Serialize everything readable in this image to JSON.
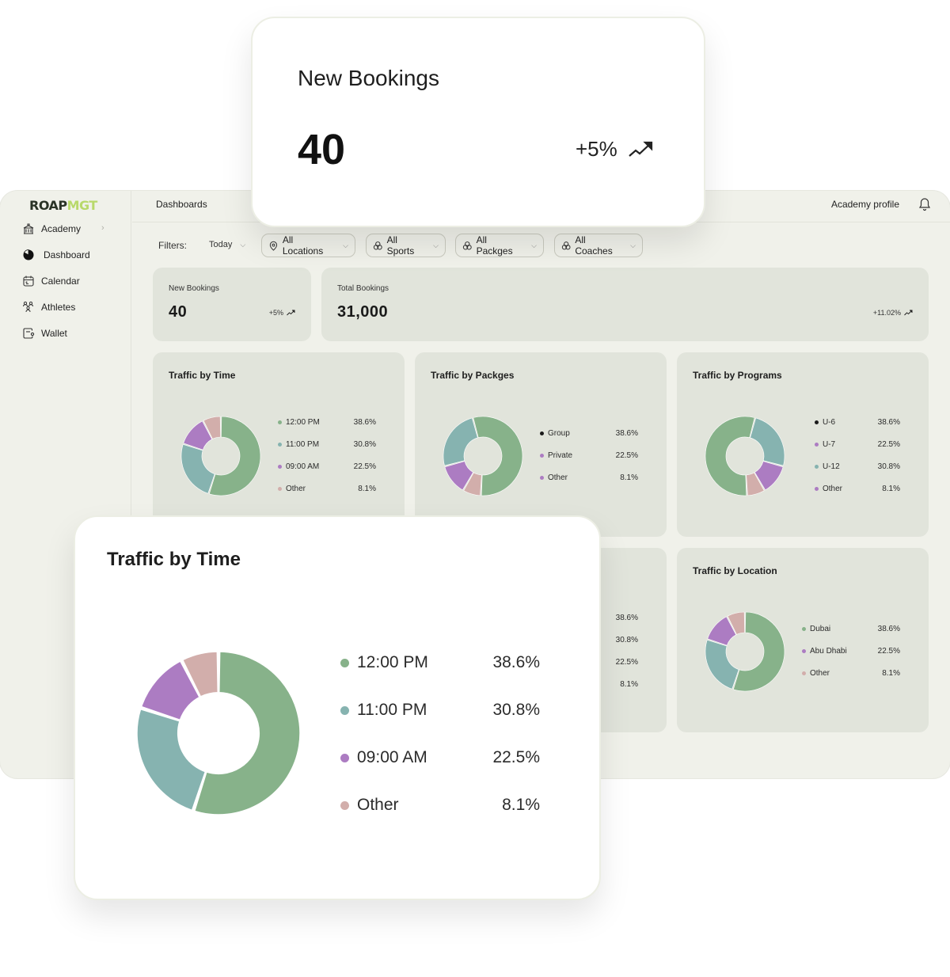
{
  "app": {
    "logo": {
      "part1": "ROAP",
      "part2": "MGT"
    },
    "sidebar": {
      "items": [
        {
          "label": "Academy",
          "icon": "building-icon",
          "has_chevron": true
        },
        {
          "label": "Dashboard",
          "icon": "pie-chart-icon"
        },
        {
          "label": "Calendar",
          "icon": "calendar-icon"
        },
        {
          "label": "Athletes",
          "icon": "users-icon"
        },
        {
          "label": "Wallet",
          "icon": "wallet-icon"
        }
      ]
    },
    "topbar": {
      "breadcrumb": "Dashboards",
      "profile": "Academy profile",
      "bell_icon": "bell-icon"
    },
    "filters": {
      "label": "Filters:",
      "date": "Today",
      "pills": [
        {
          "label": "All Locations",
          "icon": "location-pin-icon"
        },
        {
          "label": "All Sports",
          "icon": "sports-icon"
        },
        {
          "label": "All Packges",
          "icon": "packages-icon"
        },
        {
          "label": "All Coaches",
          "icon": "coaches-icon"
        }
      ]
    },
    "stats": {
      "new_bookings": {
        "label": "New Bookings",
        "value": "40",
        "change": "+5%"
      },
      "total_bookings": {
        "label": "Total Bookings",
        "value": "31,000",
        "change": "+11.02%"
      }
    },
    "colors": {
      "green": "#87b28a",
      "teal": "#86b3b0",
      "purple": "#ac7cc2",
      "pink": "#d2aeab",
      "black": "#1a1a1a",
      "logo_dark": "#2a3326",
      "logo_lime": "#b8d96a"
    }
  },
  "floating": {
    "new_bookings": {
      "label": "New Bookings",
      "value": "40",
      "change": "+5%"
    },
    "traffic_by_time": {
      "title": "Traffic by Time"
    }
  },
  "chart_data": [
    {
      "type": "pie",
      "id": "traffic-by-time",
      "title": "Traffic by Time",
      "legend": [
        {
          "label": "12:00 PM",
          "value": "38.6%",
          "color": "green"
        },
        {
          "label": "11:00 PM",
          "value": "30.8%",
          "color": "teal"
        },
        {
          "label": "09:00 AM",
          "value": "22.5%",
          "color": "purple"
        },
        {
          "label": "Other",
          "value": "8.1%",
          "color": "pink"
        }
      ],
      "slices": [
        {
          "color": "green",
          "value": 55
        },
        {
          "color": "teal",
          "value": 25
        },
        {
          "color": "purple",
          "value": 12.5
        },
        {
          "color": "pink",
          "value": 7.5
        }
      ]
    },
    {
      "type": "pie",
      "id": "traffic-by-packages",
      "title": "Traffic by Packges",
      "legend": [
        {
          "label": "Group",
          "value": "38.6%",
          "color": "black"
        },
        {
          "label": "Private",
          "value": "22.5%",
          "color": "purple"
        },
        {
          "label": "Other",
          "value": "8.1%",
          "color": "purple"
        }
      ],
      "slices": [
        {
          "color": "green",
          "value": 55
        },
        {
          "color": "pink",
          "value": 7.5
        },
        {
          "color": "purple",
          "value": 12.5
        },
        {
          "color": "teal",
          "value": 25
        }
      ]
    },
    {
      "type": "pie",
      "id": "traffic-by-programs",
      "title": "Traffic by Programs",
      "legend": [
        {
          "label": "U-6",
          "value": "38.6%",
          "color": "black"
        },
        {
          "label": "U-7",
          "value": "22.5%",
          "color": "purple"
        },
        {
          "label": "U-12",
          "value": "30.8%",
          "color": "teal"
        },
        {
          "label": "Other",
          "value": "8.1%",
          "color": "purple"
        }
      ],
      "slices": [
        {
          "color": "teal",
          "value": 25
        },
        {
          "color": "purple",
          "value": 12.5
        },
        {
          "color": "pink",
          "value": 7.5
        },
        {
          "color": "green",
          "value": 55
        }
      ]
    },
    {
      "type": "pie",
      "id": "traffic-by-hidden",
      "title": "",
      "legend": [
        {
          "label": "",
          "value": "38.6%",
          "color": "green"
        },
        {
          "label": "",
          "value": "30.8%",
          "color": "teal"
        },
        {
          "label": "",
          "value": "22.5%",
          "color": "purple"
        },
        {
          "label": "",
          "value": "8.1%",
          "color": "pink"
        }
      ],
      "slices": []
    },
    {
      "type": "pie",
      "id": "traffic-by-location",
      "title": "Traffic by Location",
      "legend": [
        {
          "label": "Dubai",
          "value": "38.6%",
          "color": "green"
        },
        {
          "label": "Abu Dhabi",
          "value": "22.5%",
          "color": "purple"
        },
        {
          "label": "Other",
          "value": "8.1%",
          "color": "pink"
        }
      ],
      "slices": [
        {
          "color": "green",
          "value": 55
        },
        {
          "color": "teal",
          "value": 25
        },
        {
          "color": "purple",
          "value": 12.5
        },
        {
          "color": "pink",
          "value": 7.5
        }
      ]
    }
  ]
}
